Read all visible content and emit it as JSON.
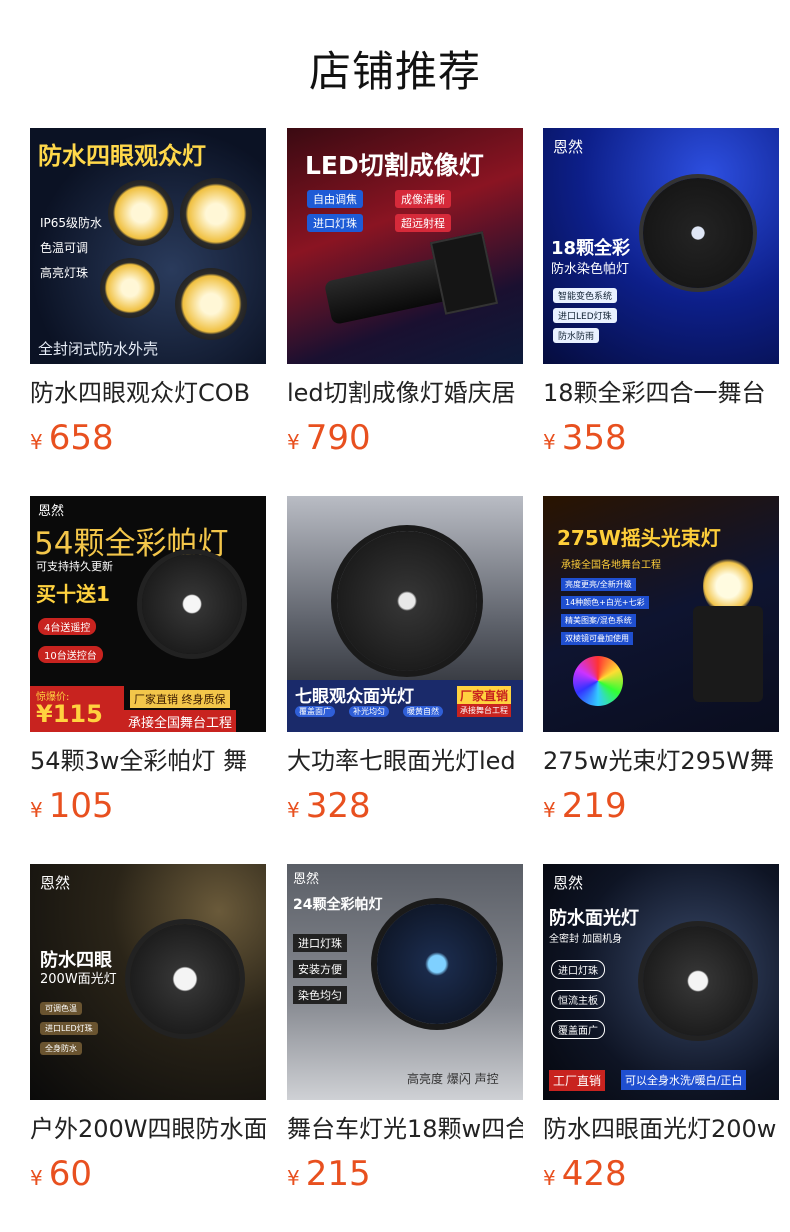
{
  "page": {
    "title": "店铺推荐"
  },
  "products": [
    {
      "name": "防水四眼观众灯COB",
      "currency": "¥",
      "price": "658",
      "image_texts": [
        "防水四眼观众灯",
        "IP65级防水",
        "色温可调",
        "高亮灯珠",
        "全封闭式防水外壳"
      ]
    },
    {
      "name": "led切割成像灯婚庆居",
      "currency": "¥",
      "price": "790",
      "image_texts": [
        "LED切割成像灯",
        "自由调焦",
        "成像清晰",
        "进口灯珠",
        "超远射程"
      ]
    },
    {
      "name": "18颗全彩四合一舞台",
      "currency": "¥",
      "price": "358",
      "image_texts": [
        "恩然",
        "18颗全彩",
        "防水染色帕灯",
        "智能变色系统",
        "进口LED灯珠",
        "防水防雨"
      ]
    },
    {
      "name": "54颗3w全彩帕灯 舞",
      "currency": "¥",
      "price": "105",
      "image_texts": [
        "恩然",
        "54颗全彩帕灯",
        "可支持持久更新",
        "买十送1",
        "4台送遥控",
        "10台送控台",
        "惊爆价:",
        "¥115",
        "厂家直销 终身质保",
        "承接全国舞台工程"
      ]
    },
    {
      "name": "大功率七眼面光灯led",
      "currency": "¥",
      "price": "328",
      "image_texts": [
        "七眼观众面光灯",
        "覆盖面广",
        "补光均匀",
        "暖黄自然",
        "厂家直销",
        "承接舞台工程"
      ]
    },
    {
      "name": "275w光束灯295W舞",
      "currency": "¥",
      "price": "219",
      "image_texts": [
        "275W摇头光束灯",
        "承接全国各地舞台工程",
        "亮度更亮/全新升级",
        "14种颜色+白光+七彩",
        "精美图案/混色系统",
        "双棱镜可叠加使用"
      ]
    },
    {
      "name": "户外200W四眼防水面",
      "currency": "¥",
      "price": "60",
      "image_texts": [
        "恩然",
        "防水四眼",
        "200W面光灯",
        "可调色温",
        "进口LED灯珠",
        "全身防水"
      ]
    },
    {
      "name": "舞台车灯光18颗w四合",
      "currency": "¥",
      "price": "215",
      "image_texts": [
        "恩然",
        "24颗全彩帕灯",
        "进口灯珠",
        "安装方便",
        "染色均匀",
        "高亮度 爆闪 声控"
      ]
    },
    {
      "name": "防水四眼面光灯200w",
      "currency": "¥",
      "price": "428",
      "image_texts": [
        "恩然",
        "防水面光灯",
        "全密封 加固机身",
        "进口灯珠",
        "恒流主板",
        "覆盖面广",
        "工厂直销",
        "可以全身水洗/暖白/正白"
      ]
    }
  ],
  "colors": {
    "price": "#e8501f",
    "title": "#111111",
    "text": "#222222"
  }
}
